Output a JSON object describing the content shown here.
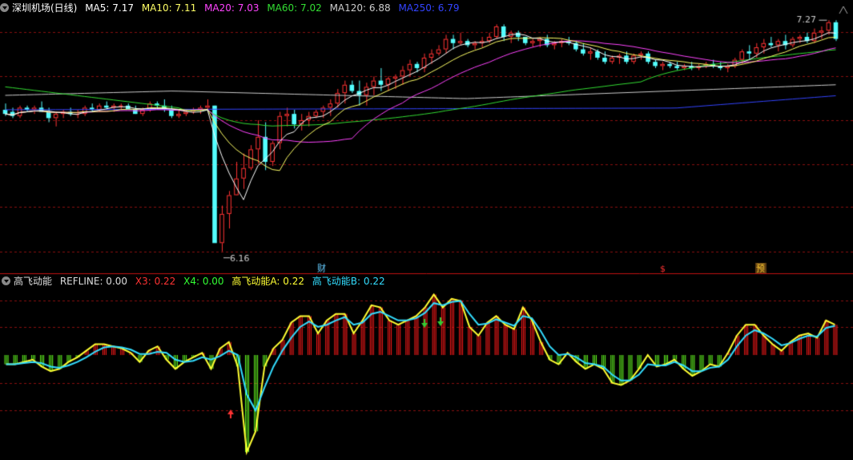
{
  "main_panel": {
    "title": "深圳机场(日线)",
    "ma_legend": [
      {
        "label": "MA5: 7.17",
        "color": "#ffffff"
      },
      {
        "label": "MA10: 7.11",
        "color": "#ffff66"
      },
      {
        "label": "MA20: 7.03",
        "color": "#ff44ff"
      },
      {
        "label": "MA60: 7.02",
        "color": "#33dd33"
      },
      {
        "label": "MA120: 6.88",
        "color": "#cccccc"
      },
      {
        "label": "MA250: 6.79",
        "color": "#3344ff"
      }
    ],
    "high_label": "7.27",
    "low_label": "6.16",
    "markers": [
      {
        "text": "财",
        "color": "#66ccff"
      },
      {
        "text": "$",
        "color": "#ff3333"
      },
      {
        "text": "预",
        "color": "#ffcc33"
      }
    ]
  },
  "sub_panel": {
    "legend": [
      {
        "label": "高飞动能",
        "color": "#dddddd"
      },
      {
        "label": "REFLINE: 0.00",
        "color": "#dddddd"
      },
      {
        "label": "X3: 0.22",
        "color": "#ff3333"
      },
      {
        "label": "X4: 0.00",
        "color": "#33ff33"
      },
      {
        "label": "高飞动能A: 0.22",
        "color": "#ffff33"
      },
      {
        "label": "高飞动能B: 0.22",
        "color": "#33ddff"
      }
    ]
  },
  "colors": {
    "up": "#ff3333",
    "down": "#54ffff",
    "grid": "#8a0f0f",
    "separator": "#c01010",
    "osc_pos": "#ff1a1a",
    "osc_neg": "#66ff22",
    "line_a": "#ffff33",
    "line_b": "#33ddff"
  },
  "chart_data": [
    {
      "type": "candlestick",
      "title": "深圳机场(日线)",
      "ylim": [
        6.16,
        7.27
      ],
      "ohlc": [
        [
          6.84,
          6.87,
          6.81,
          6.82
        ],
        [
          6.83,
          6.85,
          6.8,
          6.81
        ],
        [
          6.81,
          6.86,
          6.8,
          6.85
        ],
        [
          6.85,
          6.86,
          6.83,
          6.84
        ],
        [
          6.84,
          6.86,
          6.82,
          6.85
        ],
        [
          6.85,
          6.88,
          6.83,
          6.83
        ],
        [
          6.83,
          6.85,
          6.78,
          6.8
        ],
        [
          6.8,
          6.83,
          6.76,
          6.82
        ],
        [
          6.82,
          6.84,
          6.8,
          6.83
        ],
        [
          6.83,
          6.85,
          6.81,
          6.82
        ],
        [
          6.82,
          6.84,
          6.8,
          6.82
        ],
        [
          6.82,
          6.86,
          6.81,
          6.85
        ],
        [
          6.85,
          6.87,
          6.83,
          6.84
        ],
        [
          6.84,
          6.87,
          6.83,
          6.86
        ],
        [
          6.86,
          6.88,
          6.84,
          6.85
        ],
        [
          6.85,
          6.87,
          6.83,
          6.86
        ],
        [
          6.86,
          6.87,
          6.84,
          6.86
        ],
        [
          6.86,
          6.87,
          6.84,
          6.84
        ],
        [
          6.84,
          6.86,
          6.82,
          6.82
        ],
        [
          6.82,
          6.85,
          6.81,
          6.84
        ],
        [
          6.84,
          6.88,
          6.83,
          6.87
        ],
        [
          6.87,
          6.88,
          6.84,
          6.86
        ],
        [
          6.86,
          6.89,
          6.83,
          6.84
        ],
        [
          6.84,
          6.86,
          6.8,
          6.81
        ],
        [
          6.81,
          6.84,
          6.8,
          6.82
        ],
        [
          6.82,
          6.84,
          6.81,
          6.83
        ],
        [
          6.83,
          6.85,
          6.82,
          6.84
        ],
        [
          6.84,
          6.86,
          6.82,
          6.85
        ],
        [
          6.85,
          6.89,
          6.84,
          6.86
        ],
        [
          6.86,
          6.86,
          6.5,
          6.2
        ],
        [
          6.2,
          6.38,
          6.16,
          6.34
        ],
        [
          6.34,
          6.45,
          6.27,
          6.43
        ],
        [
          6.43,
          6.59,
          6.43,
          6.51
        ],
        [
          6.51,
          6.63,
          6.46,
          6.56
        ],
        [
          6.56,
          6.67,
          6.55,
          6.65
        ],
        [
          6.65,
          6.79,
          6.58,
          6.71
        ],
        [
          6.71,
          6.78,
          6.55,
          6.59
        ],
        [
          6.59,
          6.69,
          6.57,
          6.68
        ],
        [
          6.68,
          6.83,
          6.65,
          6.81
        ],
        [
          6.81,
          6.85,
          6.76,
          6.82
        ],
        [
          6.82,
          6.84,
          6.75,
          6.77
        ],
        [
          6.77,
          6.82,
          6.74,
          6.79
        ],
        [
          6.79,
          6.83,
          6.76,
          6.81
        ],
        [
          6.81,
          6.84,
          6.8,
          6.83
        ],
        [
          6.83,
          6.86,
          6.8,
          6.85
        ],
        [
          6.85,
          6.89,
          6.81,
          6.87
        ],
        [
          6.87,
          6.94,
          6.85,
          6.92
        ],
        [
          6.92,
          6.98,
          6.87,
          6.96
        ],
        [
          6.96,
          6.98,
          6.92,
          6.93
        ],
        [
          6.93,
          6.98,
          6.86,
          6.91
        ],
        [
          6.91,
          6.97,
          6.86,
          6.95
        ],
        [
          6.95,
          7.0,
          6.91,
          6.98
        ],
        [
          6.98,
          7.04,
          6.93,
          6.96
        ],
        [
          6.96,
          7.0,
          6.93,
          6.99
        ],
        [
          6.99,
          7.01,
          6.94,
          7.0
        ],
        [
          7.0,
          7.05,
          6.96,
          7.03
        ],
        [
          7.03,
          7.08,
          7.0,
          7.06
        ],
        [
          7.06,
          7.07,
          7.02,
          7.04
        ],
        [
          7.04,
          7.11,
          7.02,
          7.09
        ],
        [
          7.09,
          7.13,
          7.06,
          7.11
        ],
        [
          7.11,
          7.15,
          7.1,
          7.13
        ],
        [
          7.13,
          7.2,
          7.11,
          7.18
        ],
        [
          7.18,
          7.2,
          7.13,
          7.16
        ],
        [
          7.16,
          7.21,
          7.15,
          7.17
        ],
        [
          7.17,
          7.18,
          7.14,
          7.15
        ],
        [
          7.15,
          7.17,
          7.13,
          7.16
        ],
        [
          7.16,
          7.19,
          7.14,
          7.17
        ],
        [
          7.17,
          7.21,
          7.16,
          7.19
        ],
        [
          7.19,
          7.25,
          7.18,
          7.24
        ],
        [
          7.24,
          7.25,
          7.17,
          7.19
        ],
        [
          7.19,
          7.22,
          7.16,
          7.21
        ],
        [
          7.21,
          7.22,
          7.17,
          7.19
        ],
        [
          7.19,
          7.19,
          7.15,
          7.16
        ],
        [
          7.16,
          7.18,
          7.14,
          7.17
        ],
        [
          7.17,
          7.19,
          7.14,
          7.18
        ],
        [
          7.18,
          7.2,
          7.14,
          7.15
        ],
        [
          7.15,
          7.17,
          7.13,
          7.16
        ],
        [
          7.16,
          7.18,
          7.14,
          7.17
        ],
        [
          7.17,
          7.19,
          7.15,
          7.16
        ],
        [
          7.16,
          7.17,
          7.12,
          7.13
        ],
        [
          7.13,
          7.16,
          7.1,
          7.11
        ],
        [
          7.11,
          7.14,
          7.08,
          7.12
        ],
        [
          7.12,
          7.13,
          7.08,
          7.09
        ],
        [
          7.09,
          7.12,
          7.06,
          7.07
        ],
        [
          7.07,
          7.1,
          7.06,
          7.09
        ],
        [
          7.09,
          7.11,
          7.06,
          7.1
        ],
        [
          7.1,
          7.12,
          7.06,
          7.07
        ],
        [
          7.07,
          7.11,
          7.06,
          7.1
        ],
        [
          7.1,
          7.12,
          7.08,
          7.11
        ],
        [
          7.11,
          7.12,
          7.06,
          7.07
        ],
        [
          7.07,
          7.08,
          7.04,
          7.05
        ],
        [
          7.05,
          7.07,
          7.03,
          7.06
        ],
        [
          7.06,
          7.07,
          7.04,
          7.05
        ],
        [
          7.05,
          7.07,
          7.03,
          7.04
        ],
        [
          7.04,
          7.06,
          7.03,
          7.05
        ],
        [
          7.05,
          7.07,
          7.03,
          7.04
        ],
        [
          7.04,
          7.06,
          7.03,
          7.05
        ],
        [
          7.05,
          7.07,
          7.04,
          7.06
        ],
        [
          7.06,
          7.08,
          7.04,
          7.05
        ],
        [
          7.05,
          7.07,
          7.03,
          7.04
        ],
        [
          7.04,
          7.06,
          7.02,
          7.05
        ],
        [
          7.05,
          7.09,
          7.04,
          7.08
        ],
        [
          7.08,
          7.13,
          7.06,
          7.12
        ],
        [
          7.12,
          7.15,
          7.08,
          7.11
        ],
        [
          7.11,
          7.16,
          7.09,
          7.14
        ],
        [
          7.14,
          7.18,
          7.11,
          7.16
        ],
        [
          7.16,
          7.19,
          7.14,
          7.15
        ],
        [
          7.15,
          7.18,
          7.12,
          7.17
        ],
        [
          7.17,
          7.2,
          7.13,
          7.15
        ],
        [
          7.15,
          7.19,
          7.14,
          7.18
        ],
        [
          7.18,
          7.2,
          7.16,
          7.19
        ],
        [
          7.19,
          7.21,
          7.16,
          7.17
        ],
        [
          7.17,
          7.23,
          7.16,
          7.21
        ],
        [
          7.21,
          7.24,
          7.18,
          7.22
        ],
        [
          7.22,
          7.27,
          7.2,
          7.26
        ],
        [
          7.26,
          7.27,
          7.17,
          7.18
        ]
      ]
    },
    {
      "type": "bar+line",
      "title": "高飞动能",
      "values": [
        -0.04,
        -0.04,
        -0.03,
        -0.02,
        -0.05,
        -0.07,
        -0.06,
        -0.03,
        -0.01,
        0.02,
        0.05,
        0.05,
        0.04,
        0.03,
        0.01,
        -0.03,
        0.02,
        0.04,
        -0.02,
        -0.06,
        -0.03,
        -0.01,
        0.01,
        -0.06,
        0.03,
        0.06,
        -0.05,
        -0.42,
        -0.33,
        -0.05,
        0.03,
        0.07,
        0.15,
        0.18,
        0.18,
        0.1,
        0.16,
        0.19,
        0.19,
        0.1,
        0.16,
        0.23,
        0.22,
        0.16,
        0.14,
        0.16,
        0.18,
        0.22,
        0.28,
        0.22,
        0.26,
        0.25,
        0.13,
        0.09,
        0.15,
        0.18,
        0.14,
        0.12,
        0.22,
        0.16,
        0.06,
        -0.02,
        -0.04,
        0.01,
        -0.03,
        -0.06,
        -0.04,
        -0.06,
        -0.12,
        -0.13,
        -0.11,
        -0.06,
        0.0,
        -0.05,
        -0.04,
        -0.02,
        -0.06,
        -0.09,
        -0.07,
        -0.04,
        -0.05,
        0.01,
        0.09,
        0.14,
        0.14,
        0.09,
        0.05,
        0.02,
        0.06,
        0.09,
        0.1,
        0.08,
        0.16,
        0.14
      ],
      "series": [
        {
          "name": "高飞动能A",
          "values": [
            -0.04,
            -0.04,
            -0.03,
            -0.02,
            -0.05,
            -0.07,
            -0.06,
            -0.03,
            -0.01,
            0.02,
            0.05,
            0.05,
            0.04,
            0.03,
            0.01,
            -0.03,
            0.02,
            0.04,
            -0.02,
            -0.06,
            -0.03,
            -0.01,
            0.01,
            -0.06,
            0.03,
            0.06,
            -0.05,
            -0.42,
            -0.33,
            -0.05,
            0.03,
            0.07,
            0.15,
            0.18,
            0.18,
            0.1,
            0.16,
            0.19,
            0.19,
            0.1,
            0.16,
            0.23,
            0.22,
            0.16,
            0.14,
            0.16,
            0.18,
            0.22,
            0.28,
            0.22,
            0.26,
            0.25,
            0.13,
            0.09,
            0.15,
            0.18,
            0.14,
            0.12,
            0.22,
            0.16,
            0.06,
            -0.02,
            -0.04,
            0.01,
            -0.03,
            -0.06,
            -0.04,
            -0.06,
            -0.12,
            -0.13,
            -0.11,
            -0.06,
            0.0,
            -0.05,
            -0.04,
            -0.02,
            -0.06,
            -0.09,
            -0.07,
            -0.04,
            -0.05,
            0.01,
            0.09,
            0.14,
            0.14,
            0.09,
            0.05,
            0.02,
            0.06,
            0.09,
            0.1,
            0.08,
            0.16,
            0.14
          ]
        },
        {
          "name": "高飞动能B",
          "values": [
            -0.04,
            -0.04,
            -0.035,
            -0.03,
            -0.035,
            -0.05,
            -0.055,
            -0.045,
            -0.03,
            -0.01,
            0.015,
            0.035,
            0.04,
            0.035,
            0.025,
            0.005,
            0.005,
            0.015,
            0.01,
            -0.02,
            -0.03,
            -0.025,
            -0.01,
            -0.02,
            -0.005,
            0.02,
            0.0,
            -0.17,
            -0.24,
            -0.14,
            -0.05,
            0.02,
            0.08,
            0.13,
            0.155,
            0.13,
            0.14,
            0.16,
            0.175,
            0.14,
            0.15,
            0.19,
            0.2,
            0.18,
            0.16,
            0.16,
            0.17,
            0.195,
            0.24,
            0.23,
            0.245,
            0.25,
            0.19,
            0.14,
            0.145,
            0.165,
            0.15,
            0.135,
            0.18,
            0.17,
            0.11,
            0.04,
            0.0,
            0.005,
            -0.01,
            -0.035,
            -0.04,
            -0.05,
            -0.085,
            -0.11,
            -0.11,
            -0.085,
            -0.04,
            -0.045,
            -0.045,
            -0.03,
            -0.045,
            -0.07,
            -0.07,
            -0.055,
            -0.05,
            -0.02,
            0.04,
            0.09,
            0.115,
            0.1,
            0.075,
            0.045,
            0.055,
            0.075,
            0.09,
            0.085,
            0.125,
            0.135
          ]
        }
      ]
    }
  ]
}
